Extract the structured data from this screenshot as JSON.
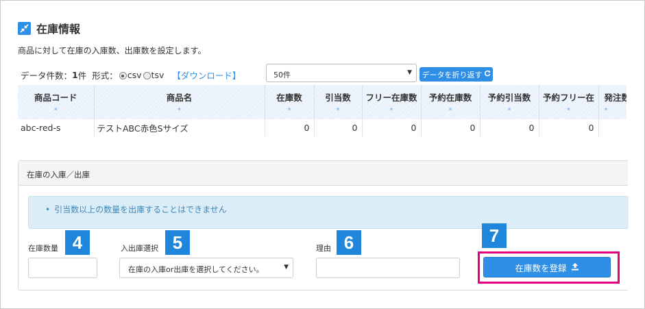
{
  "section": {
    "title": "在庫情報",
    "title_icon": "compress-arrows-icon",
    "description": "商品に対して在庫の入庫数、出庫数を設定します。"
  },
  "meta": {
    "count_label": "データ件数：",
    "count_value": "1",
    "count_unit": "件",
    "format_label": "形式：",
    "format_options": [
      "csv",
      "tsv"
    ],
    "format_selected": "csv",
    "download_link": "【ダウンロード】"
  },
  "per_page": {
    "selected": "50件"
  },
  "wrap_button": {
    "label": "データを折り返す"
  },
  "table": {
    "headers": [
      "商品コード",
      "商品名",
      "在庫数",
      "引当数",
      "フリー在庫数",
      "予約在庫数",
      "予約引当数",
      "予約フリー在",
      "発注数"
    ],
    "sort_marker": "*",
    "rows": [
      [
        "abc-red-s",
        "テストABC赤色Sサイズ",
        "0",
        "0",
        "0",
        "0",
        "0",
        "0",
        ""
      ]
    ]
  },
  "panel": {
    "title": "在庫の入庫／出庫",
    "alert": "引当数以上の数量を出庫することはできません",
    "fields": {
      "quantity_label": "在庫数量",
      "direction_label": "入出庫選択",
      "direction_placeholder": "在庫の入庫or出庫を選択してください。",
      "reason_label": "理由"
    },
    "badges": [
      "4",
      "5",
      "6",
      "7"
    ],
    "register_button": "在庫数を登録"
  },
  "colors": {
    "accent": "#2f8fe6",
    "badge": "#1f86dc",
    "highlight": "#e4007f",
    "alert_bg": "#dcedf7"
  }
}
